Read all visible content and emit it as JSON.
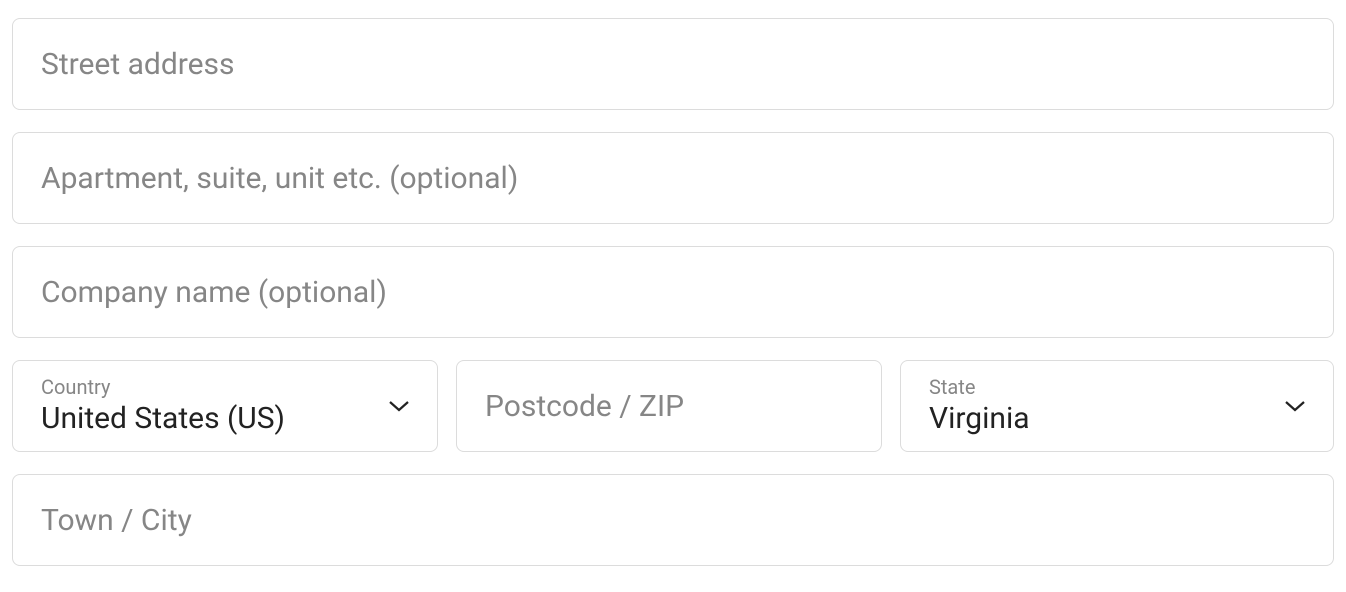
{
  "address": {
    "street_placeholder": "Street address",
    "street_value": "",
    "apt_placeholder": "Apartment, suite, unit etc. (optional)",
    "apt_value": "",
    "company_placeholder": "Company name (optional)",
    "company_value": "",
    "country_label": "Country",
    "country_value": "United States (US)",
    "postcode_placeholder": "Postcode / ZIP",
    "postcode_value": "",
    "state_label": "State",
    "state_value": "Virginia",
    "city_placeholder": "Town / City",
    "city_value": ""
  }
}
